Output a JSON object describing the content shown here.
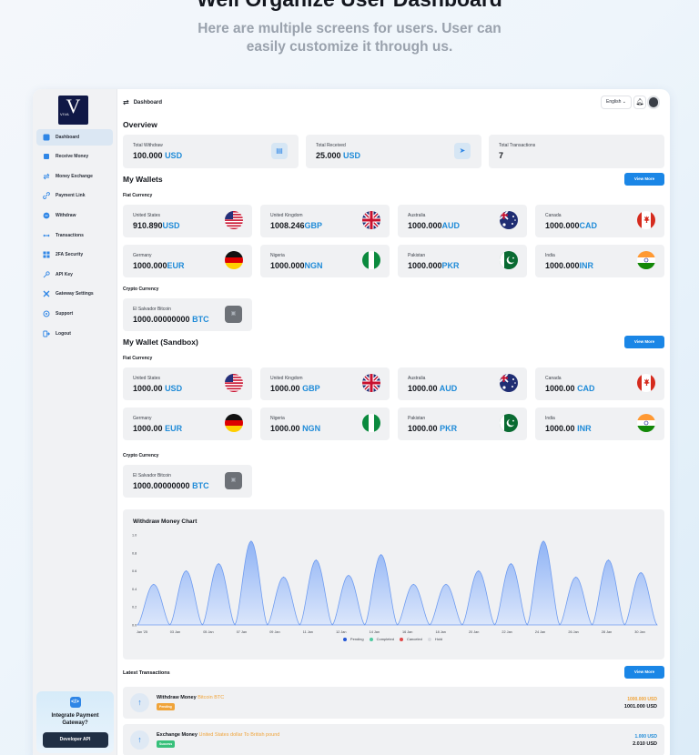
{
  "hero": {
    "title": "Well Organize User Dashboard",
    "subtitle": "Here are multiple screens for users. User can easily customize it through us."
  },
  "logo": {
    "letter": "V",
    "text": "VIVA"
  },
  "sidebar": {
    "items": [
      {
        "label": "Dashboard",
        "icon": "dashboard-icon",
        "active": true
      },
      {
        "label": "Receive Money",
        "icon": "receive-icon"
      },
      {
        "label": "Money Exchange",
        "icon": "exchange-icon"
      },
      {
        "label": "Payment Link",
        "icon": "link-icon"
      },
      {
        "label": "Withdraw",
        "icon": "withdraw-icon"
      },
      {
        "label": "Transactions",
        "icon": "transactions-icon"
      },
      {
        "label": "2FA Security",
        "icon": "security-icon"
      },
      {
        "label": "API Key",
        "icon": "key-icon"
      },
      {
        "label": "Gateway Settings",
        "icon": "settings-icon"
      },
      {
        "label": "Support",
        "icon": "support-icon"
      },
      {
        "label": "Logout",
        "icon": "logout-icon"
      }
    ],
    "promo": {
      "text": "Integrate Payment Gateway?",
      "button": "Developer API"
    }
  },
  "topbar": {
    "breadcrumb": "Dashboard",
    "language": "English"
  },
  "overview": {
    "title": "Overview",
    "cards": [
      {
        "label": "Total Withdraw",
        "amount": "100.000",
        "currency": "USD"
      },
      {
        "label": "Total Received",
        "amount": "25.000",
        "currency": "USD"
      },
      {
        "label": "Total Transactions",
        "amount": "7",
        "currency": ""
      }
    ]
  },
  "wallets": {
    "title": "My Wallets",
    "view_more": "View More",
    "fiat_label": "Fiat Currency",
    "crypto_label": "Crypto Currency",
    "fiat": [
      {
        "country": "United States",
        "amount": "910.890",
        "currency": "USD",
        "flag": "us"
      },
      {
        "country": "United Kingdom",
        "amount": "1008.246",
        "currency": "GBP",
        "flag": "gb"
      },
      {
        "country": "Australia",
        "amount": "1000.000",
        "currency": "AUD",
        "flag": "au"
      },
      {
        "country": "Canada",
        "amount": "1000.000",
        "currency": "CAD",
        "flag": "ca"
      },
      {
        "country": "Germany",
        "amount": "1000.000",
        "currency": "EUR",
        "flag": "de"
      },
      {
        "country": "Nigeria",
        "amount": "1000.000",
        "currency": "NGN",
        "flag": "ng"
      },
      {
        "country": "Pakistan",
        "amount": "1000.000",
        "currency": "PKR",
        "flag": "pk"
      },
      {
        "country": "India",
        "amount": "1000.000",
        "currency": "INR",
        "flag": "in"
      }
    ],
    "crypto": [
      {
        "country": "El Salvador Bitcoin",
        "amount": "1000.00000000",
        "currency": "BTC"
      }
    ]
  },
  "sandbox": {
    "title": "My Wallet (Sandbox)",
    "view_more": "View More",
    "fiat_label": "Fiat Currency",
    "crypto_label": "Crypto Currency",
    "fiat": [
      {
        "country": "United States",
        "amount": "1000.00",
        "currency": "USD",
        "flag": "us"
      },
      {
        "country": "United Kingdom",
        "amount": "1000.00",
        "currency": "GBP",
        "flag": "gb"
      },
      {
        "country": "Australia",
        "amount": "1000.00",
        "currency": "AUD",
        "flag": "au"
      },
      {
        "country": "Canada",
        "amount": "1000.00",
        "currency": "CAD",
        "flag": "ca"
      },
      {
        "country": "Germany",
        "amount": "1000.00",
        "currency": "EUR",
        "flag": "de"
      },
      {
        "country": "Nigeria",
        "amount": "1000.00",
        "currency": "NGN",
        "flag": "ng"
      },
      {
        "country": "Pakistan",
        "amount": "1000.00",
        "currency": "PKR",
        "flag": "pk"
      },
      {
        "country": "India",
        "amount": "1000.00",
        "currency": "INR",
        "flag": "in"
      }
    ],
    "crypto": [
      {
        "country": "El Salvador Bitcoin",
        "amount": "1000.00000000",
        "currency": "BTC"
      }
    ]
  },
  "chart_data": {
    "type": "area",
    "title": "Withdraw Money Chart",
    "y_ticks": [
      "1.0",
      "0.8",
      "0.6",
      "0.4",
      "0.2",
      "0.0"
    ],
    "ylim": [
      0,
      1
    ],
    "x_ticks": [
      "Jan '25",
      "03 Jan",
      "05 Jan",
      "07 Jan",
      "09 Jan",
      "11 Jan",
      "12 Jan",
      "14 Jan",
      "16 Jan",
      "18 Jan",
      "20 Jan",
      "22 Jan",
      "24 Jan",
      "26 Jan",
      "28 Jan",
      "30 Jan"
    ],
    "peaks": [
      0.45,
      0.6,
      0.68,
      0.93,
      0.53,
      0.72,
      0.55,
      0.78,
      0.45,
      0.45,
      0.6,
      0.68,
      0.93,
      0.53,
      0.72,
      0.58
    ],
    "legend": [
      {
        "name": "Pending",
        "color": "#2457d6"
      },
      {
        "name": "Completed",
        "color": "#4fc9a0"
      },
      {
        "name": "Canceled",
        "color": "#e04848"
      },
      {
        "name": "Hold",
        "color": "#d9dbe0"
      }
    ],
    "fill_color": "#8fb3f5",
    "grid": false
  },
  "latest": {
    "title": "Latest Transactions",
    "view_more": "View More",
    "items": [
      {
        "title": "Withdraw Money",
        "detail": "Bitcoin BTC",
        "badge": "Pending",
        "badge_color": "#f0a43a",
        "amount1": "1000.000 USD",
        "amount1_color": "#f0a43a",
        "amount2": "1001.000 USD"
      },
      {
        "title": "Exchange Money",
        "detail": "United States dollar To British pound",
        "badge": "Success",
        "badge_color": "#37c07a",
        "amount1": "1.000 USD",
        "amount1_color": "#1f8bd8",
        "amount2": "2.010 USD"
      }
    ]
  }
}
